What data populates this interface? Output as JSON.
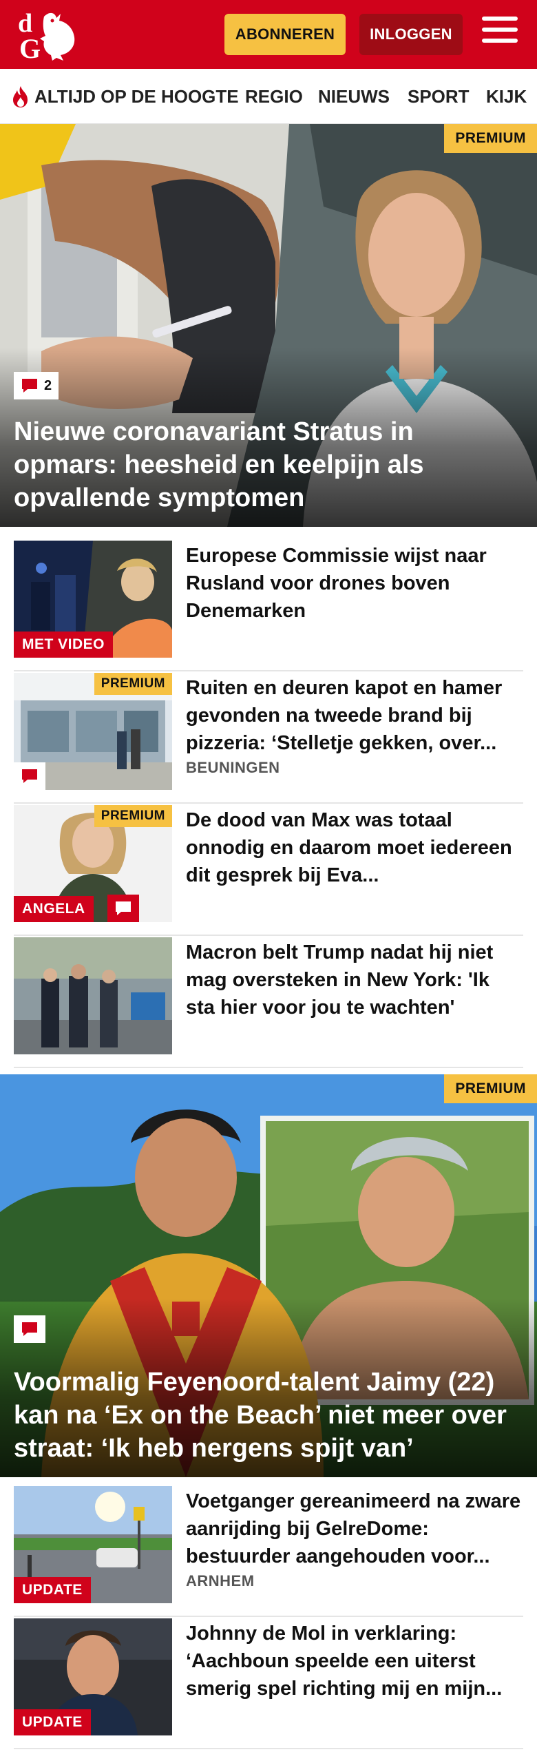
{
  "header": {
    "logo_text": "dG",
    "subscribe_label": "ABONNEREN",
    "login_label": "INLOGGEN"
  },
  "nav": {
    "items": [
      {
        "label": "ALTIJD OP DE HOOGTE"
      },
      {
        "label": "REGIO"
      },
      {
        "label": "NIEUWS"
      },
      {
        "label": "SPORT"
      },
      {
        "label": "KIJK"
      }
    ]
  },
  "hero1": {
    "premium_label": "PREMIUM",
    "comment_count": "2",
    "title": "Nieuwe coronavariant Stratus in opmars: heesheid en keelpijn als opvallende symptomen"
  },
  "articles": [
    {
      "title": "Europese Commissie wijst naar Rusland voor drones boven Denemarken",
      "label": "MET VIDEO",
      "meta": ""
    },
    {
      "title": "Ruiten en deuren kapot en hamer gevonden na tweede brand bij pizzeria: ‘Stelletje gekken, over...",
      "premium": "PREMIUM",
      "meta": "BEUNINGEN"
    },
    {
      "title": "De dood van Max was totaal onnodig en daarom moet iedereen dit gesprek bij Eva...",
      "premium": "PREMIUM",
      "label": "ANGELA",
      "meta": ""
    },
    {
      "title": "Macron belt Trump nadat hij niet mag oversteken in New York: 'Ik sta hier voor jou te wachten'",
      "meta": ""
    }
  ],
  "hero2": {
    "premium_label": "PREMIUM",
    "title": "Voormalig Feyenoord-talent Jaimy (22) kan na ‘Ex on the Beach’ niet meer over straat: ‘Ik heb nergens spijt van’"
  },
  "articles2": [
    {
      "title": "Voetganger gereanimeerd na zware aanrijding bij GelreDome: bestuurder aangehouden voor...",
      "label": "UPDATE",
      "meta": "ARNHEM"
    },
    {
      "title": "Johnny de Mol in verklaring: ‘Aachboun speelde een uiterst smerig spel richting mij en mijn...",
      "label": "UPDATE",
      "meta": ""
    }
  ],
  "colors": {
    "brand_red": "#d0021b",
    "dark_red": "#9e0c15",
    "premium_yellow": "#f6c142"
  },
  "icons": [
    "logo-rooster-icon",
    "hamburger-menu-icon",
    "flame-icon",
    "comment-bubble-icon"
  ]
}
